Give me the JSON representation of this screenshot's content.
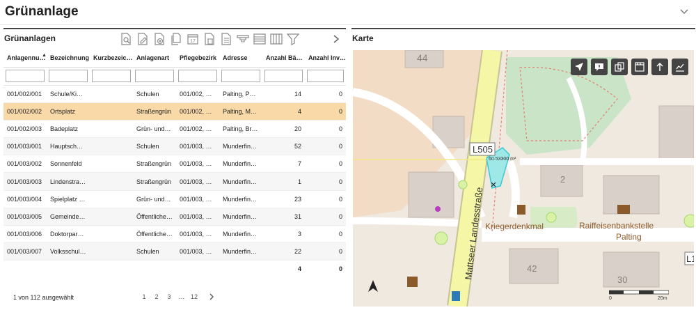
{
  "page": {
    "title": "Grünanlage"
  },
  "left_panel": {
    "title": "Grünanlagen",
    "toolbar": [
      {
        "icon": "search-document-icon"
      },
      {
        "icon": "edit-document-icon"
      },
      {
        "icon": "add-document-icon"
      },
      {
        "icon": "copy-document-icon"
      },
      {
        "icon": "calendar-icon",
        "label": "17"
      },
      {
        "icon": "delete-document-icon"
      },
      {
        "icon": "document-icon"
      },
      {
        "icon": "highlighter-icon"
      },
      {
        "icon": "list-view-icon"
      },
      {
        "icon": "columns-icon"
      },
      {
        "icon": "filter-icon"
      }
    ],
    "columns": [
      "Anlagennu…",
      "Bezeichnung",
      "Kurzbezeic…",
      "Anlagenart",
      "Pflegebezirk",
      "Adresse",
      "Anzahl Bä…",
      "Anzahl Inv…"
    ],
    "rows": [
      {
        "nr": "001/002/001",
        "bez": "Schule/Kind…",
        "kurz": "",
        "art": "Schulen",
        "bezirk": "001/002, Pal…",
        "adresse": "Palting, Palti…",
        "baeume": "14",
        "inv": "0"
      },
      {
        "nr": "001/002/002",
        "bez": "Ortsplatz",
        "kurz": "",
        "art": "Straßengrün",
        "bezirk": "001/002, Pal…",
        "adresse": "Palting, Matt…",
        "baeume": "4",
        "inv": "0"
      },
      {
        "nr": "001/002/003",
        "bez": "Badeplatz",
        "kurz": "",
        "art": "Grün- und P…",
        "bezirk": "001/002, Pal…",
        "adresse": "Palting, Bruc…",
        "baeume": "20",
        "inv": "0"
      },
      {
        "nr": "001/003/001",
        "bez": "Hauptschule…",
        "kurz": "",
        "art": "Schulen",
        "bezirk": "001/003, Mu…",
        "adresse": "Munderfing, …",
        "baeume": "52",
        "inv": "0"
      },
      {
        "nr": "001/003/002",
        "bez": "Sonnenfeld",
        "kurz": "",
        "art": "Straßengrün",
        "bezirk": "001/003, Mu…",
        "adresse": "Munderfing, …",
        "baeume": "7",
        "inv": "0"
      },
      {
        "nr": "001/003/003",
        "bez": "Lindenstraß…",
        "kurz": "",
        "art": "Straßengrün",
        "bezirk": "001/003, Mu…",
        "adresse": "Munderfing, …",
        "baeume": "1",
        "inv": "0"
      },
      {
        "nr": "001/003/004",
        "bez": "Spielplatz ev…",
        "kurz": "",
        "art": "Grün- und P…",
        "bezirk": "001/003, Mu…",
        "adresse": "Munderfing, …",
        "baeume": "23",
        "inv": "0"
      },
      {
        "nr": "001/003/005",
        "bez": "Gemeindeamt",
        "kurz": "",
        "art": "Öffentliche …",
        "bezirk": "001/003, Mu…",
        "adresse": "Munderfing, …",
        "baeume": "31",
        "inv": "0"
      },
      {
        "nr": "001/003/006",
        "bez": "Doktorparklatz",
        "kurz": "",
        "art": "Öffentliche …",
        "bezirk": "001/003, Mu…",
        "adresse": "Munderfing, …",
        "baeume": "3",
        "inv": "0"
      },
      {
        "nr": "001/003/007",
        "bez": "Volksschule …",
        "kurz": "",
        "art": "Schulen",
        "bezirk": "001/003, Mu…",
        "adresse": "Munderfing, …",
        "baeume": "22",
        "inv": "0"
      }
    ],
    "selected_row_index": 1,
    "sums": {
      "baeume": "4",
      "inv": "0"
    },
    "footer": {
      "selected_text": "1 von 112 ausgewählt",
      "pages": [
        "1",
        "2",
        "3",
        "…",
        "12"
      ]
    }
  },
  "right_panel": {
    "title": "Karte",
    "map_labels": {
      "street": "Mattseer Landesstraße",
      "road_ref": "L505",
      "road_ref2": "L1",
      "poi1": "Kriegerdenkmal",
      "poi2a": "Raiffeisenbankstelle",
      "poi2b": "Palting",
      "house_44": "44",
      "house_2": "2",
      "house_42": "42",
      "house_30": "30",
      "measure": "60.53300 m²"
    },
    "map_tools": [
      "navigate-icon",
      "info-icon",
      "layers-icon",
      "film-icon",
      "upload-icon",
      "chart-icon"
    ],
    "scale": {
      "start": "0",
      "end": "20m"
    }
  }
}
